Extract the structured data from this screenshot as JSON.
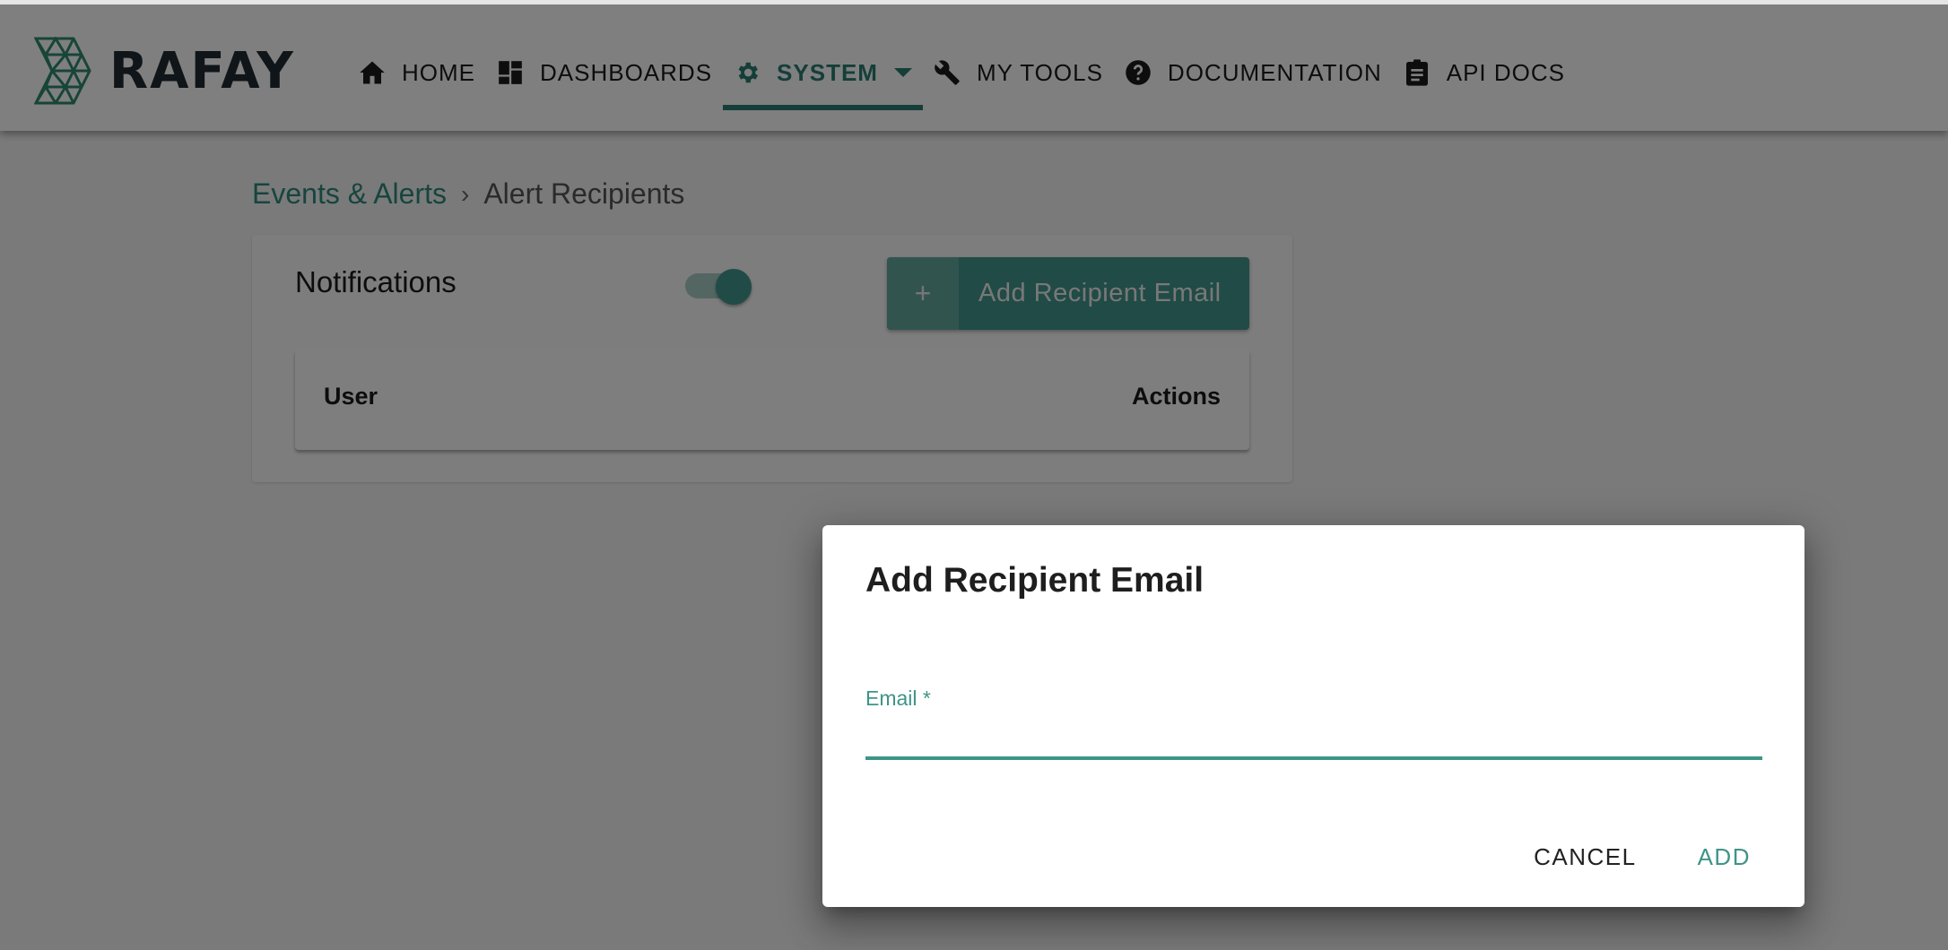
{
  "brand": {
    "name": "RAFAY",
    "primary_color": "#42968c",
    "logo_color": "#2e8a6e"
  },
  "nav": {
    "items": [
      {
        "label": "HOME",
        "icon": "home-icon",
        "active": false
      },
      {
        "label": "DASHBOARDS",
        "icon": "dashboard-icon",
        "active": false
      },
      {
        "label": "SYSTEM",
        "icon": "gear-icon",
        "active": true,
        "has_dropdown": true
      },
      {
        "label": "MY TOOLS",
        "icon": "wrench-icon",
        "active": false
      },
      {
        "label": "DOCUMENTATION",
        "icon": "help-circle-icon",
        "active": false
      },
      {
        "label": "API DOCS",
        "icon": "clipboard-icon",
        "active": false
      }
    ]
  },
  "breadcrumb": {
    "parent": "Events & Alerts",
    "separator": "›",
    "current": "Alert Recipients"
  },
  "card": {
    "title": "Notifications",
    "notifications_enabled": true,
    "add_button": {
      "icon": "+",
      "label": "Add Recipient Email"
    },
    "table": {
      "columns": [
        "User",
        "Actions"
      ],
      "rows": []
    }
  },
  "dialog": {
    "title": "Add Recipient Email",
    "email_field": {
      "label": "Email *",
      "value": "",
      "placeholder": ""
    },
    "cancel_label": "CANCEL",
    "add_label": "ADD"
  }
}
